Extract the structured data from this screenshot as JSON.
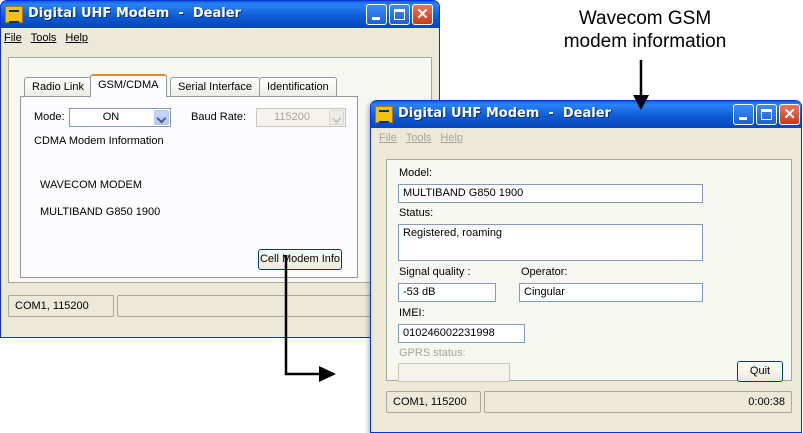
{
  "annotation": {
    "line1": "Wavecom GSM",
    "line2": "modem information"
  },
  "back_window": {
    "title": "Digital UHF Modem  -  Dealer",
    "menu": [
      "File",
      "Tools",
      "Help"
    ],
    "tabs": [
      "Radio Link",
      "GSM/CDMA",
      "Serial Interface",
      "Identification"
    ],
    "mode_label": "Mode:",
    "mode_value": "ON",
    "baud_label": "Baud Rate:",
    "baud_value": "115200",
    "section_title": "CDMA Modem Information",
    "modem_name": "WAVECOM MODEM",
    "modem_model": "MULTIBAND  G850  1900",
    "cell_button": "Cell Modem Info",
    "status_port": "COM1, 115200"
  },
  "front_window": {
    "title": "Digital UHF Modem  -  Dealer",
    "menu": [
      "File",
      "Tools",
      "Help"
    ],
    "model_label": "Model:",
    "model_value": "MULTIBAND  G850  1900",
    "status_label": "Status:",
    "status_value": "Registered, roaming",
    "signal_label": "Signal quality :",
    "signal_value": "-53 dB",
    "operator_label": "Operator:",
    "operator_value": "Cingular",
    "imei_label": "IMEI:",
    "imei_value": "010246002231998",
    "gprs_label": "GPRS status:",
    "gprs_value": "",
    "quit_button": "Quit",
    "status_port": "COM1, 115200",
    "status_time": "0:00:38"
  },
  "colors": {
    "title_blue": "#0b5ad4",
    "tab_highlight": "#e68b2c",
    "window_face": "#ece9d8"
  }
}
